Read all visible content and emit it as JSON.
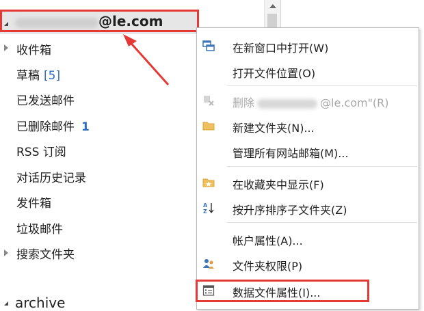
{
  "account": {
    "name_suffix": "@le.com"
  },
  "folders": [
    {
      "label": "收件箱",
      "count": ""
    },
    {
      "label": "草稿",
      "count": "[5]"
    },
    {
      "label": "已发送邮件",
      "count": ""
    },
    {
      "label": "已删除邮件",
      "count": "1"
    },
    {
      "label": "RSS 订阅",
      "count": ""
    },
    {
      "label": "对话历史记录",
      "count": ""
    },
    {
      "label": "发件箱",
      "count": ""
    },
    {
      "label": "垃圾邮件",
      "count": ""
    },
    {
      "label": "搜索文件夹",
      "count": ""
    }
  ],
  "archive": {
    "label": "archive"
  },
  "menu": {
    "items": [
      {
        "label": "在新窗口中打开(W)",
        "icon": "new-window-icon"
      },
      {
        "label": "打开文件位置(O)",
        "icon": ""
      },
      {
        "label_prefix": "删除",
        "label_suffix": "@le.com\"(R)",
        "icon": "delete-account-icon",
        "disabled": true
      },
      {
        "label": "新建文件夹(N)...",
        "icon": "folder-icon"
      },
      {
        "label": "管理所有网站邮箱(M)...",
        "icon": ""
      },
      {
        "label": "在收藏夹中显示(F)",
        "icon": "favorites-icon"
      },
      {
        "label": "按升序排序子文件夹(Z)",
        "icon": "sort-az-icon"
      },
      {
        "label": "帐户属性(A)...",
        "icon": ""
      },
      {
        "label": "文件夹权限(P)",
        "icon": "permissions-icon"
      },
      {
        "label": "数据文件属性(I)...",
        "icon": "data-file-properties-icon"
      }
    ]
  },
  "colors": {
    "highlight": "#e53935",
    "accent": "#2b6cc4",
    "folder": "#f0c060"
  }
}
